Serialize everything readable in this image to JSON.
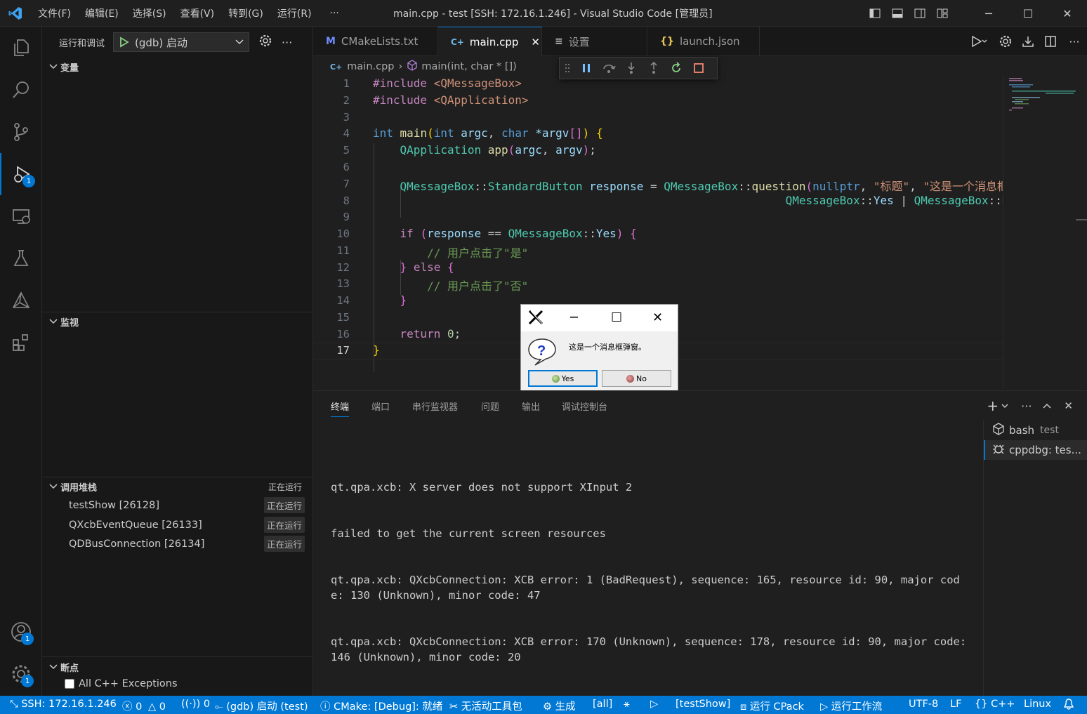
{
  "window": {
    "title": "main.cpp - test [SSH: 172.16.1.246] - Visual Studio Code [管理员]",
    "menu": [
      "文件(F)",
      "编辑(E)",
      "选择(S)",
      "查看(V)",
      "转到(G)",
      "运行(R)",
      "···"
    ]
  },
  "sidebar": {
    "run_label": "运行和调试",
    "config": "(gdb) 启动",
    "sections": {
      "variables": "变量",
      "watch": "监视",
      "callstack": "调用堆栈",
      "callstack_status": "正在运行",
      "breakpoints": "断点"
    },
    "threads": [
      {
        "name": "testShow [26128]",
        "status": "正在运行"
      },
      {
        "name": "QXcbEventQueue [26133]",
        "status": "正在运行"
      },
      {
        "name": "QDBusConnection [26134]",
        "status": "正在运行"
      }
    ],
    "breakpoint_item": "All C++ Exceptions"
  },
  "activity": {
    "debug_badge": "1",
    "account_badge": "1",
    "settings_badge": "1"
  },
  "tabs": [
    {
      "icon": "M",
      "label": "CMakeLists.txt"
    },
    {
      "icon": "C+",
      "label": "main.cpp"
    },
    {
      "icon": "≡",
      "label": "设置"
    },
    {
      "icon": "{}",
      "label": "launch.json"
    }
  ],
  "breadcrumb": {
    "file": "main.cpp",
    "symbol": "main(int, char * [])"
  },
  "editor": {
    "line_numbers": [
      "1",
      "2",
      "3",
      "4",
      "5",
      "6",
      "7",
      "8",
      "9",
      "10",
      "11",
      "12",
      "13",
      "14",
      "15",
      "16",
      "17"
    ],
    "current_line": "17"
  },
  "dialog": {
    "message": "这是一个消息框弹窗。",
    "yes": "Yes",
    "no": "No"
  },
  "panel": {
    "tabs": [
      "终端",
      "端口",
      "串行监视器",
      "问题",
      "输出",
      "调试控制台"
    ],
    "terminal_lines": [
      "qt.qpa.xcb: X server does not support XInput 2",
      "failed to get the current screen resources",
      "qt.qpa.xcb: QXcbConnection: XCB error: 1 (BadRequest), sequence: 165, resource id: 90, major code: 130 (Unknown), minor code: 47",
      "qt.qpa.xcb: QXcbConnection: XCB error: 170 (Unknown), sequence: 178, resource id: 90, major code: 146 (Unknown), minor code: 20"
    ],
    "terminals": [
      {
        "name": "bash",
        "detail": "test"
      },
      {
        "name": "cppdbg: tes...",
        "detail": ""
      }
    ]
  },
  "statusbar": {
    "remote": "SSH: 172.16.1.246",
    "errors": "0",
    "warnings": "0",
    "ports": "0",
    "debug": "(gdb) 启动 (test)",
    "cmake": "CMake: [Debug]: 就绪",
    "kit": "无活动工具包",
    "build": "生成",
    "target": "[all]",
    "launch_target": "[testShow]",
    "cpack": "运行 CPack",
    "workflow": "运行工作流",
    "encoding": "UTF-8",
    "eol": "LF",
    "language": "C++",
    "platform": "Linux"
  }
}
